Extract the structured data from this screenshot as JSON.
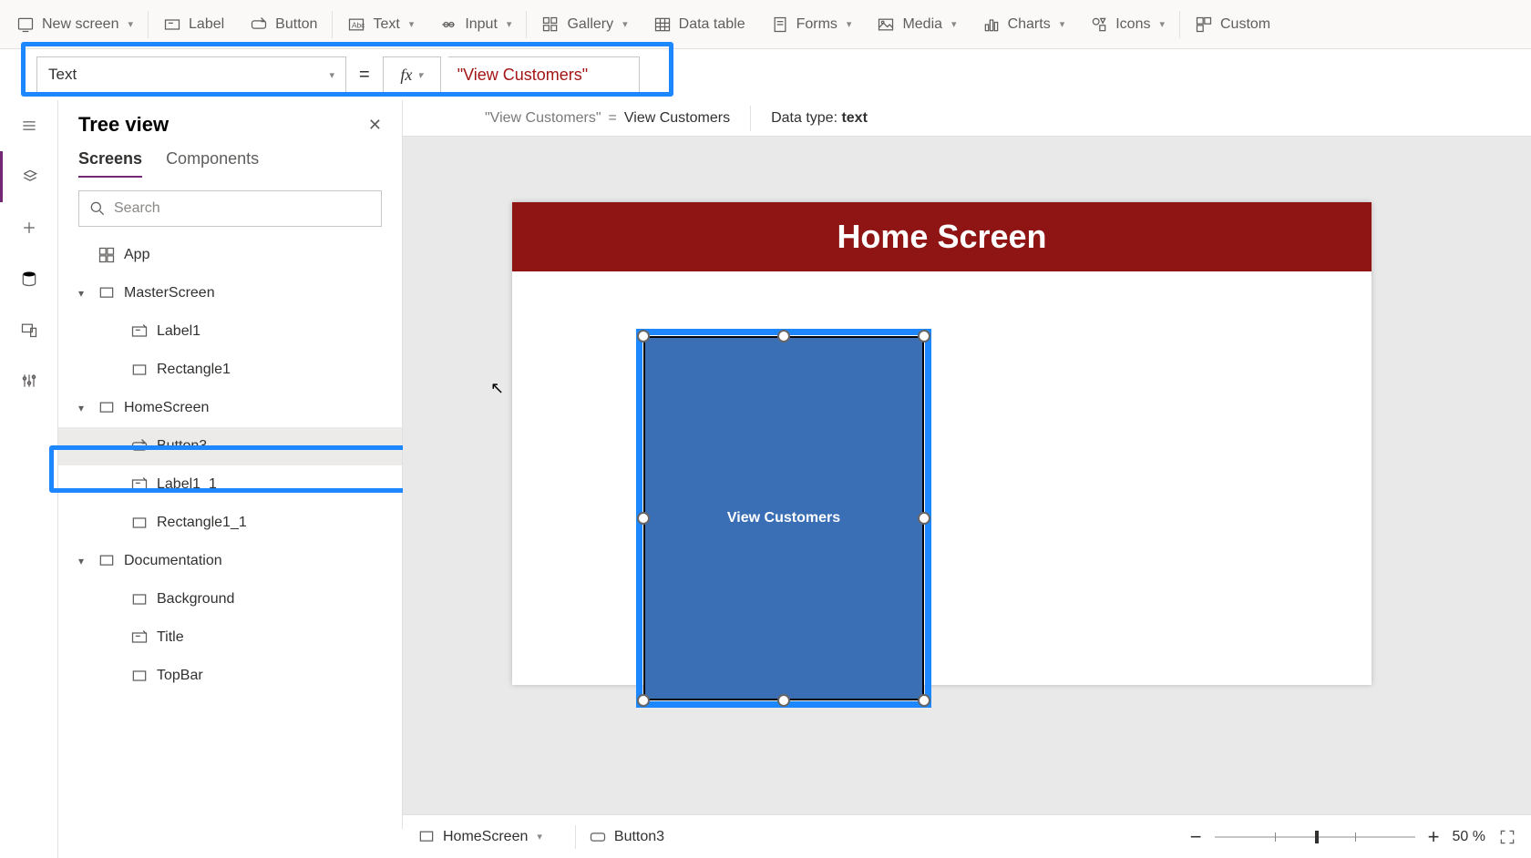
{
  "toolbar": {
    "new_screen": "New screen",
    "label": "Label",
    "button": "Button",
    "text": "Text",
    "input": "Input",
    "gallery": "Gallery",
    "data_table": "Data table",
    "forms": "Forms",
    "media": "Media",
    "charts": "Charts",
    "icons": "Icons",
    "custom": "Custom"
  },
  "formula": {
    "property": "Text",
    "fx_label": "fx",
    "value": "\"View Customers\""
  },
  "eval": {
    "lhs": "\"View Customers\"",
    "eq": "=",
    "rhs": "View Customers",
    "type_label": "Data type: ",
    "type_value": "text"
  },
  "tree": {
    "title": "Tree view",
    "tabs": {
      "screens": "Screens",
      "components": "Components"
    },
    "search_placeholder": "Search",
    "items": [
      {
        "label": "App",
        "kind": "app",
        "indent": 0
      },
      {
        "label": "MasterScreen",
        "kind": "screen",
        "indent": 1,
        "caret": true
      },
      {
        "label": "Label1",
        "kind": "label",
        "indent": 2
      },
      {
        "label": "Rectangle1",
        "kind": "rect",
        "indent": 2
      },
      {
        "label": "HomeScreen",
        "kind": "screen",
        "indent": 1,
        "caret": true
      },
      {
        "label": "Button3",
        "kind": "button",
        "indent": 2,
        "selected": true,
        "more": true
      },
      {
        "label": "Label1_1",
        "kind": "label",
        "indent": 2
      },
      {
        "label": "Rectangle1_1",
        "kind": "rect",
        "indent": 2
      },
      {
        "label": "Documentation",
        "kind": "screen",
        "indent": 1,
        "caret": true
      },
      {
        "label": "Background",
        "kind": "rect",
        "indent": 2
      },
      {
        "label": "Title",
        "kind": "label",
        "indent": 2
      },
      {
        "label": "TopBar",
        "kind": "rect",
        "indent": 2
      }
    ]
  },
  "canvas": {
    "header": "Home Screen",
    "button_text": "View Customers"
  },
  "breadcrumb": {
    "screen": "HomeScreen",
    "control": "Button3"
  },
  "zoom": {
    "value": "50",
    "unit": "%"
  }
}
